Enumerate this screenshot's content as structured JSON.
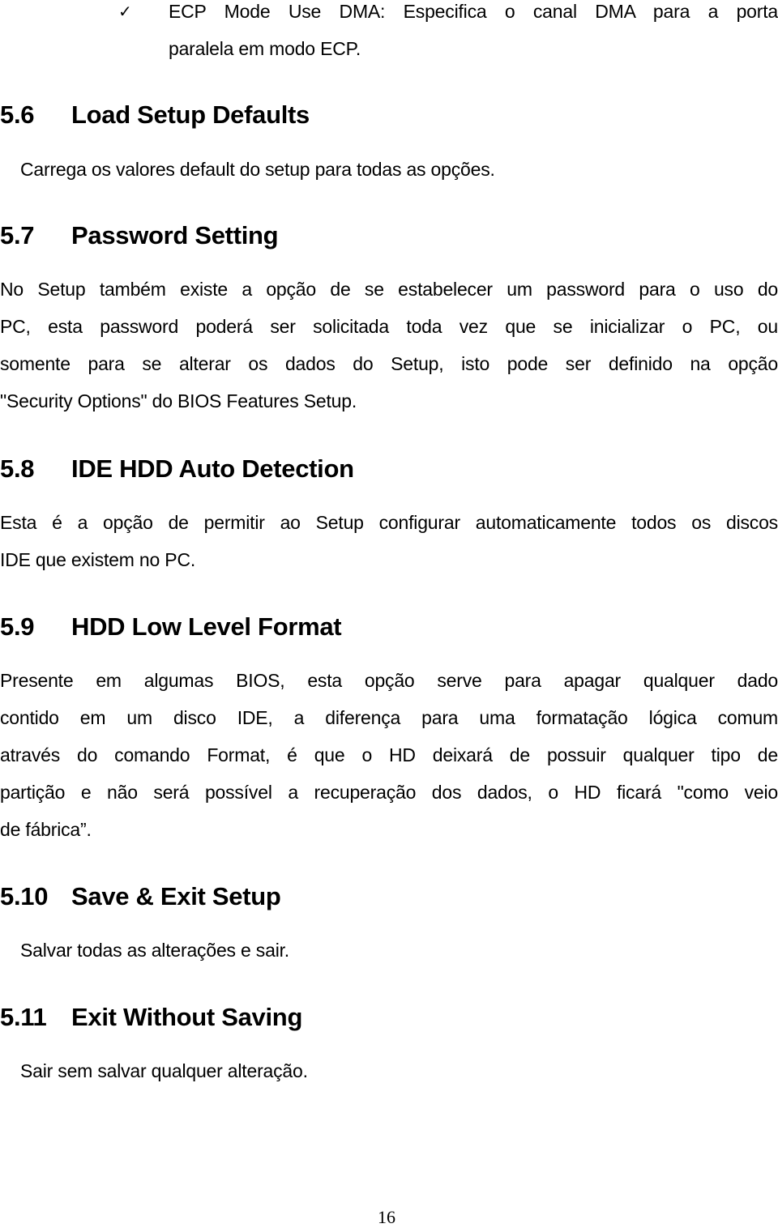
{
  "bullet": {
    "icon": "checkmark-icon",
    "icon_glyph": "✓",
    "lines": [
      "ECP Mode Use DMA: Especifica o canal DMA para a porta",
      "paralela em modo ECP."
    ]
  },
  "sections": [
    {
      "number": "5.6",
      "title": "Load Setup Defaults",
      "lines": [
        "Carrega os valores default do setup para todas as opções."
      ]
    },
    {
      "number": "5.7",
      "title": "Password Setting",
      "lines": [
        "No Setup também existe a opção de se estabelecer um password para o uso do",
        "PC, esta password poderá ser solicitada toda vez que se inicializar o PC, ou",
        "somente para se alterar os dados do Setup, isto pode ser definido na opção",
        "\"Security Options\" do BIOS Features Setup."
      ]
    },
    {
      "number": "5.8",
      "title": "IDE HDD Auto Detection",
      "lines": [
        "Esta é a opção de permitir ao Setup configurar automaticamente todos os discos",
        "IDE que existem no PC."
      ]
    },
    {
      "number": "5.9",
      "title": "HDD Low Level Format",
      "lines": [
        "Presente em algumas BIOS, esta opção serve para apagar qualquer dado",
        "contido em um disco IDE, a diferença para uma formatação lógica comum",
        "através do comando Format, é que o HD deixará de possuir qualquer tipo de",
        "partição e não será possível a recuperação dos dados, o HD ficará \"como veio",
        "de fábrica”."
      ]
    },
    {
      "number": "5.10",
      "title": "Save & Exit Setup",
      "lines": [
        "Salvar todas as alterações e sair."
      ]
    },
    {
      "number": "5.11",
      "title": "Exit Without Saving",
      "lines": [
        "Sair sem salvar qualquer alteração."
      ]
    }
  ],
  "footer": {
    "page_number": "16"
  }
}
